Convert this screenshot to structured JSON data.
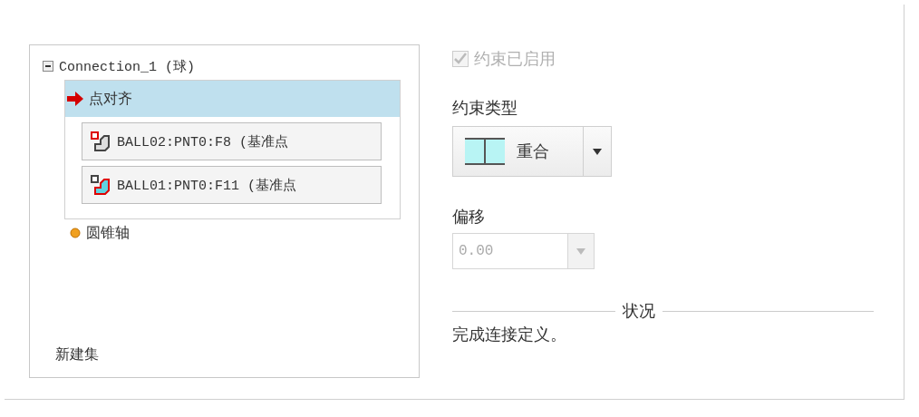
{
  "connection": {
    "label": "Connection_1 (球)",
    "expanded": true,
    "constraints": [
      {
        "label": "点对齐",
        "selected": true,
        "references": [
          "BALL02:PNT0:F8 (基准点",
          "BALL01:PNT0:F11 (基准点"
        ]
      },
      {
        "label": "圆锥轴",
        "selected": false
      }
    ]
  },
  "new_set": "新建集",
  "enabled": {
    "label": "约束已启用",
    "checked": true,
    "disabled": true
  },
  "constraint_type": {
    "label": "约束类型",
    "value": "重合"
  },
  "offset": {
    "label": "偏移",
    "value": "0.00",
    "disabled": true
  },
  "status": {
    "title": "状况",
    "message": "完成连接定义。"
  }
}
